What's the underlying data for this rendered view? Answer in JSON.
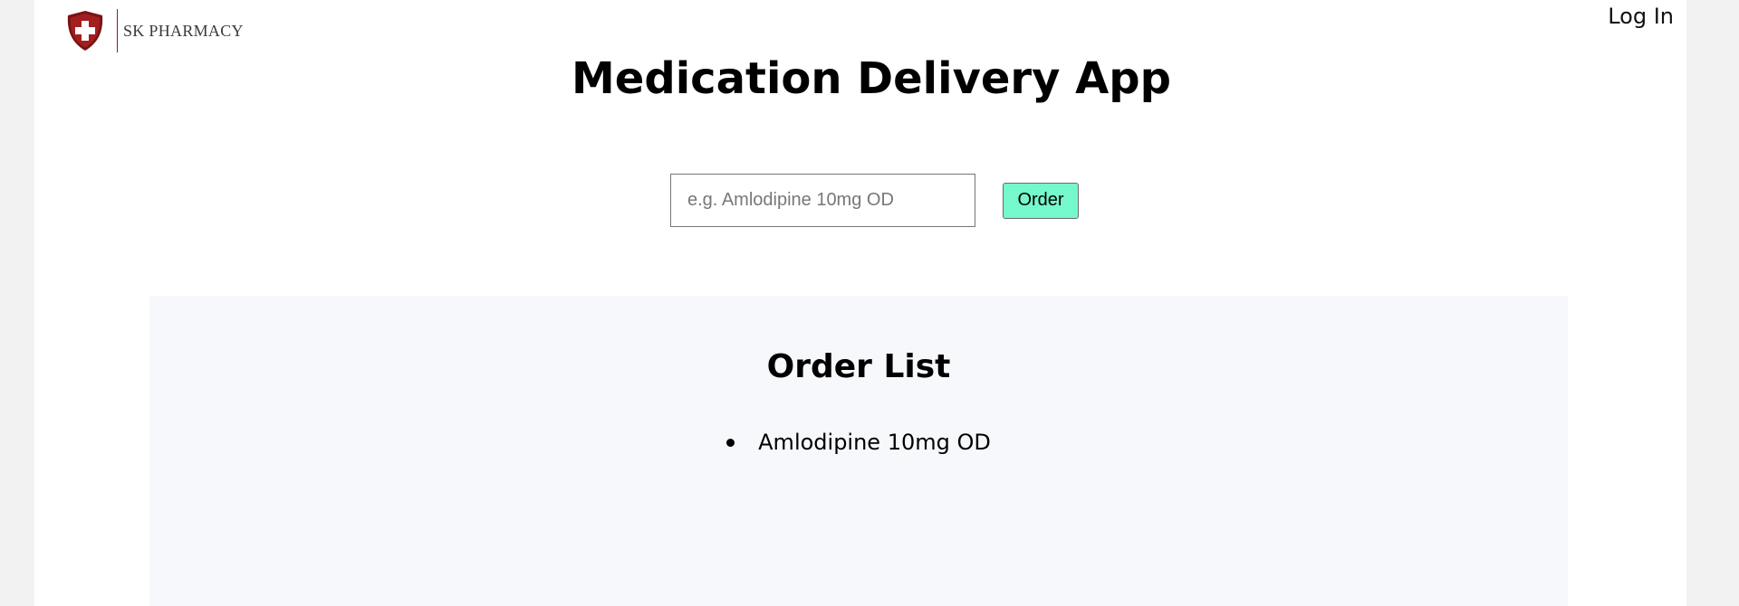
{
  "header": {
    "brand_name": "SK PHARMACY",
    "login_label": "Log In",
    "logo_icon": "shield-cross-icon"
  },
  "main": {
    "title": "Medication Delivery App",
    "medication_input": {
      "value": "",
      "placeholder": "e.g. Amlodipine 10mg OD"
    },
    "order_button_label": "Order"
  },
  "order_list": {
    "title": "Order List",
    "items": [
      {
        "label": "Amlodipine 10mg OD"
      }
    ]
  },
  "colors": {
    "order_button": "#75f8cc",
    "logo_red": "#9b1c1c",
    "page_background": "#f2f2f2",
    "list_background": "#f7f8fc"
  }
}
